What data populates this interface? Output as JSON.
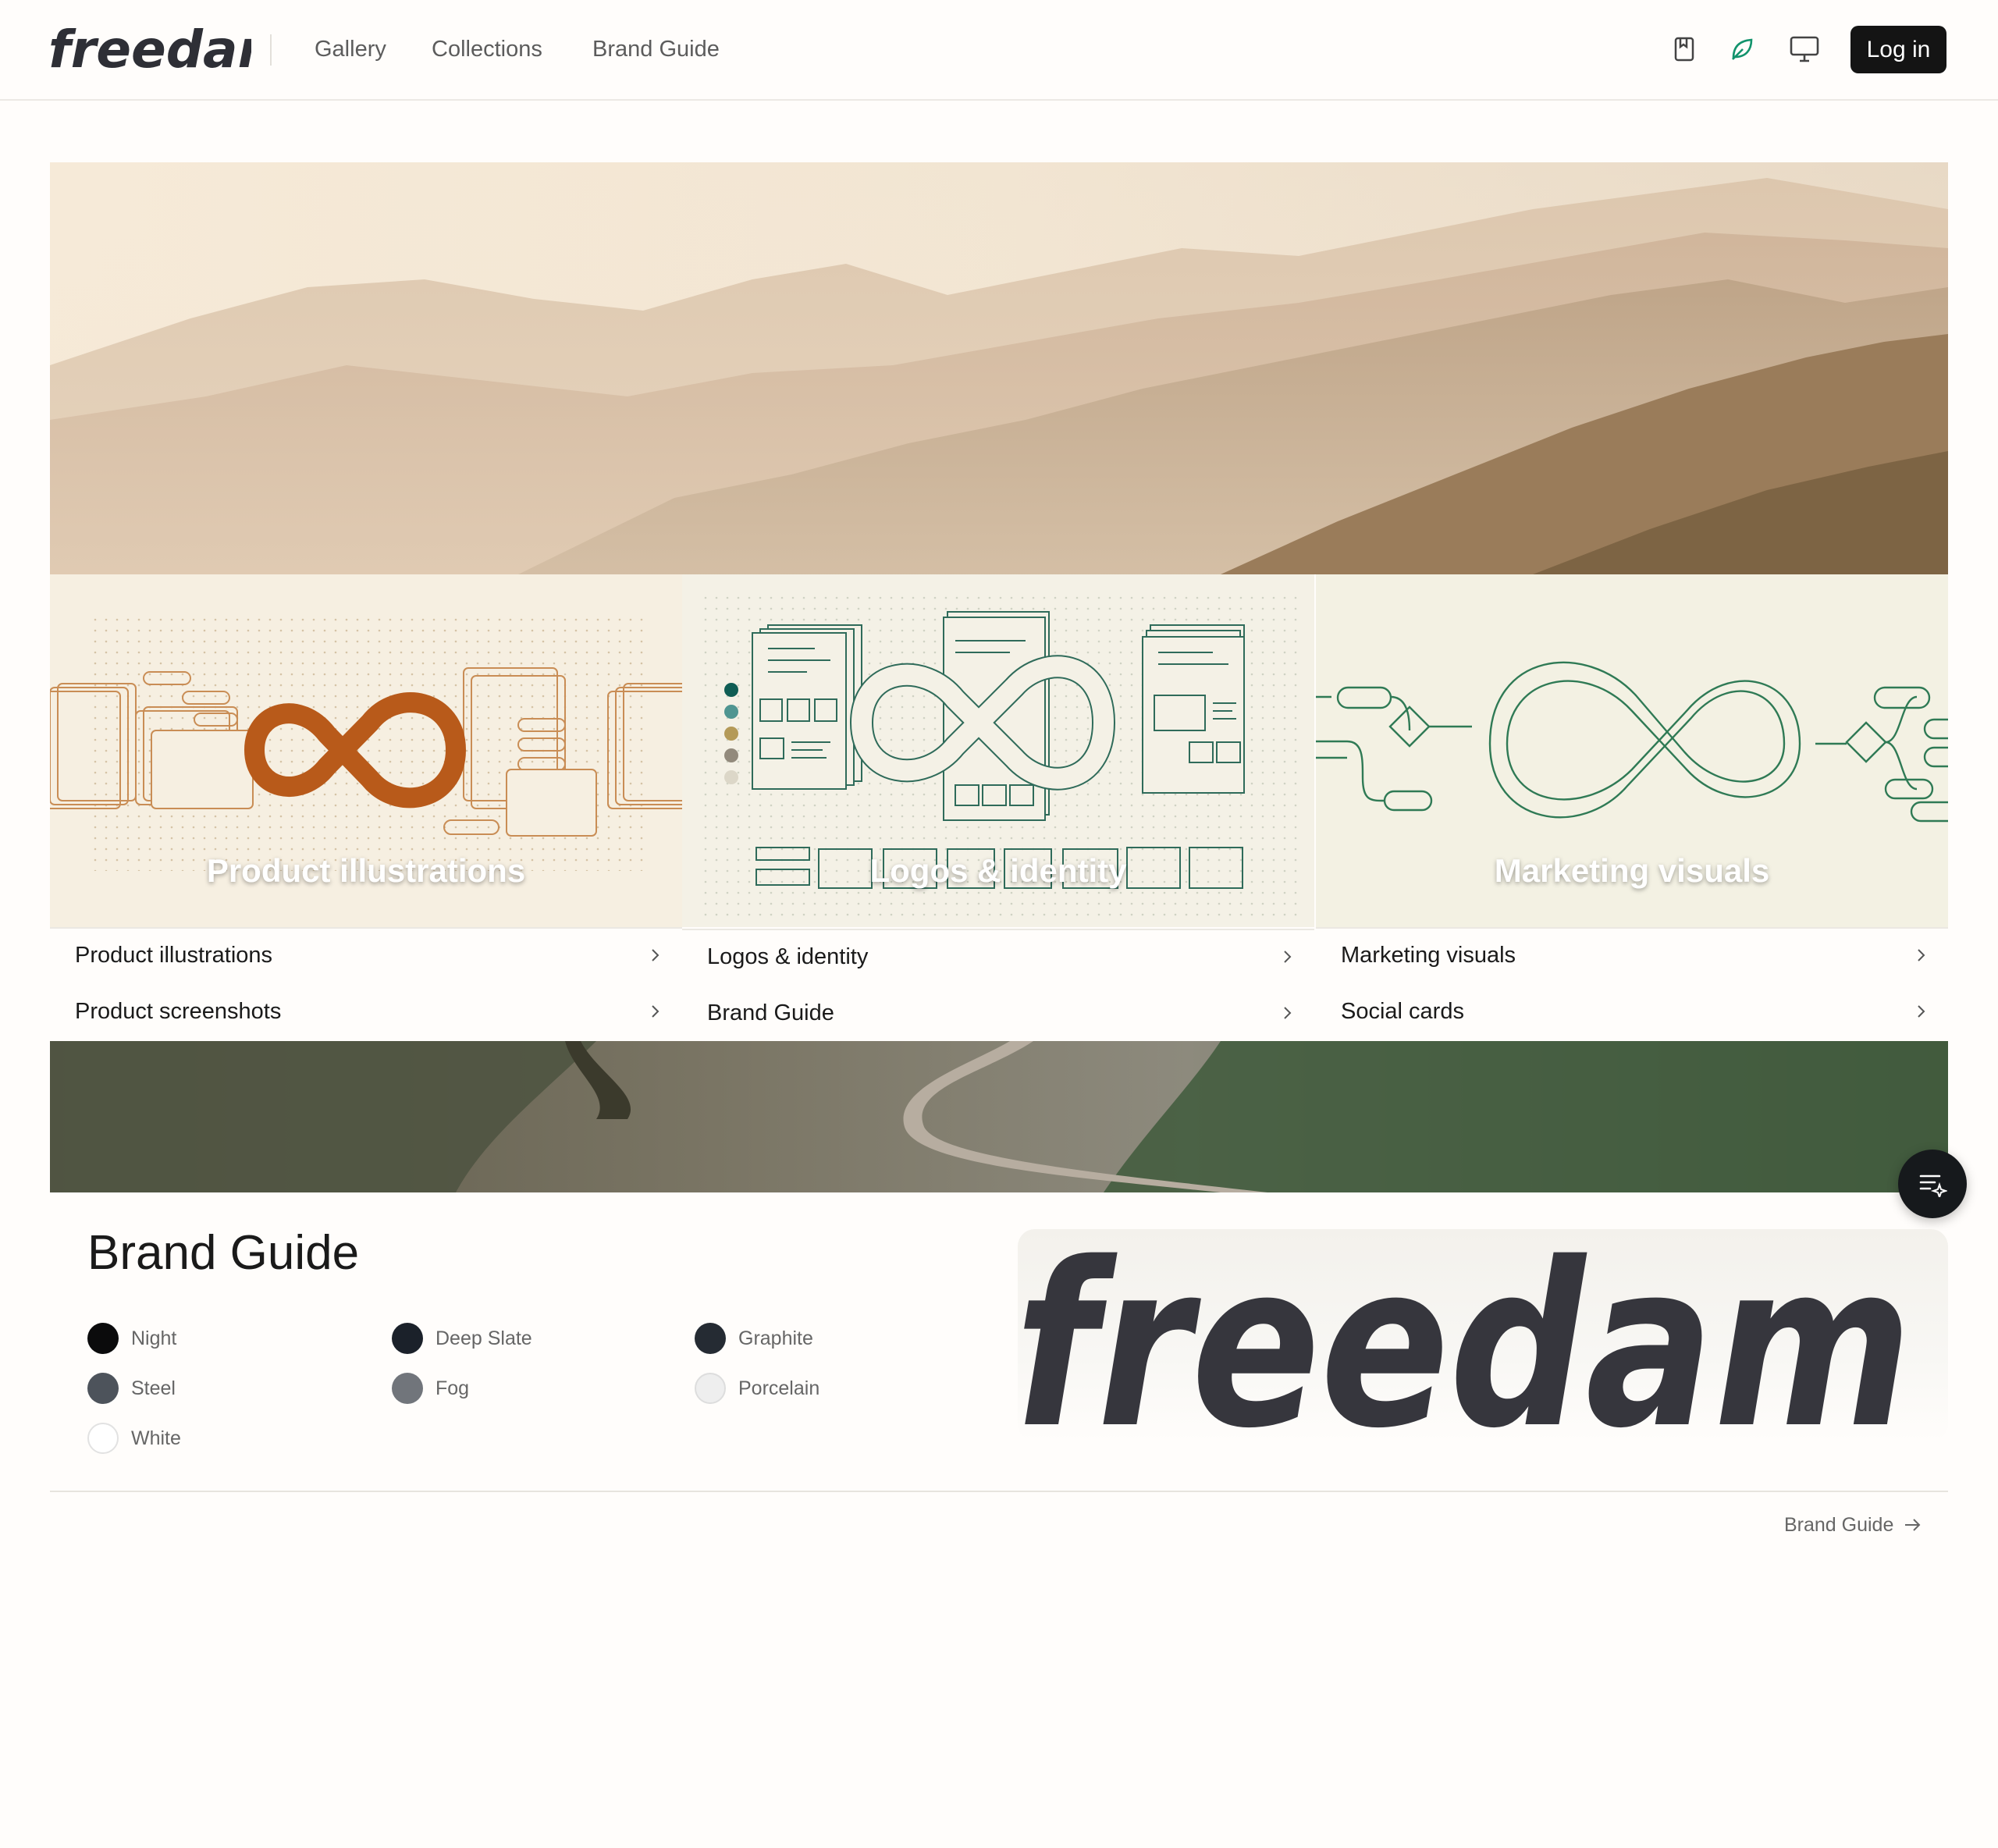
{
  "header": {
    "logo_text": "freedam",
    "nav": [
      "Gallery",
      "Collections",
      "Brand Guide"
    ],
    "icons": [
      "bookmark-icon",
      "leaf-icon",
      "monitor-icon"
    ],
    "login_label": "Log in"
  },
  "cards": [
    {
      "title": "Product illustrations",
      "links": [
        "Product illustrations",
        "Product screenshots"
      ],
      "accent": "#b85a1a",
      "bg": "#f6efe1"
    },
    {
      "title": "Logos & identity",
      "links": [
        "Logos & identity",
        "Brand Guide"
      ],
      "accent": "#2f6b5a",
      "bg": "#f4f1e6"
    },
    {
      "title": "Marketing visuals",
      "links": [
        "Marketing visuals",
        "Social cards"
      ],
      "accent": "#2f7a55",
      "bg": "#f3f1e3"
    }
  ],
  "brand_guide": {
    "title": "Brand Guide",
    "swatches": [
      {
        "name": "Night",
        "color": "#0b0b0c"
      },
      {
        "name": "Deep Slate",
        "color": "#1b212a"
      },
      {
        "name": "Graphite",
        "color": "#252b33"
      },
      {
        "name": "Steel",
        "color": "#4d535b"
      },
      {
        "name": "Fog",
        "color": "#71757b"
      },
      {
        "name": "Porcelain",
        "color": "#eeeeee"
      },
      {
        "name": "White",
        "color": "#ffffff"
      }
    ],
    "wordmark": "freedam",
    "footer_link": "Brand Guide"
  }
}
